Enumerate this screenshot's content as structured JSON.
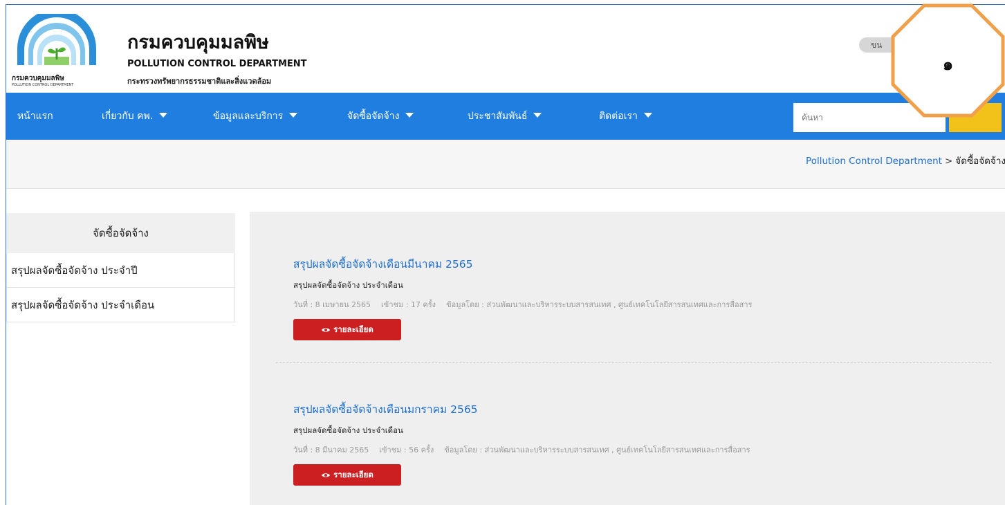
{
  "header": {
    "logo_caption_th": "กรมควบคุมมลพิษ",
    "logo_caption_en": "POLLUTION CONTROL DEPARTMENT",
    "title_th": "กรมควบคุมมลพิษ",
    "title_en": "POLLUTION CONTROL DEPARTMENT",
    "ministry": "กระทรวงทรัพยากรธรรมชาติและสิ่งแวดล้อม",
    "lang_label": "ขน"
  },
  "nav": {
    "items": [
      {
        "label": "หน้าแรก",
        "dropdown": false
      },
      {
        "label": "เกี่ยวกับ คพ.",
        "dropdown": true
      },
      {
        "label": "ข้อมูลและบริการ",
        "dropdown": true
      },
      {
        "label": "จัดซื้อจัดจ้าง",
        "dropdown": true
      },
      {
        "label": "ประชาสัมพันธ์",
        "dropdown": true
      },
      {
        "label": "ติดต่อเรา",
        "dropdown": true
      }
    ],
    "search_placeholder": "ค้นหา"
  },
  "breadcrumb": {
    "home": "Pollution Control Department",
    "separator": ">",
    "current": "จัดซื้อจัดจ้าง"
  },
  "sidebar": {
    "title": "จัดซื้อจัดจ้าง",
    "items": [
      {
        "label": "สรุปผลจัดซื้อจัดจ้าง ประจำปี"
      },
      {
        "label": "สรุปผลจัดซื้อจัดจ้าง ประจำเดือน"
      }
    ]
  },
  "posts": [
    {
      "title": "สรุปผลจัดซื้อจัดจ้างเดือนมีนาคม 2565",
      "category": "สรุปผลจัดซื้อจัดจ้าง ประจำเดือน",
      "date": "วันที่ : 8 เมษายน 2565",
      "views": "เข้าชม : 17 ครั้ง",
      "source": "ข้อมูลโดย : ส่วนพัฒนาและบริหารระบบสารสนเทศ , ศูนย์เทคโนโลยีสารสนเทศและการสื่อสาร",
      "button_label": "รายละเอียด"
    },
    {
      "title": "สรุปผลจัดซื้อจัดจ้างเดือนมกราคม 2565",
      "category": "สรุปผลจัดซื้อจัดจ้าง ประจำเดือน",
      "date": "วันที่ : 8 มีนาคม 2565",
      "views": "เข้าชม : 56 ครั้ง",
      "source": "ข้อมูลโดย : ส่วนพัฒนาและบริหารระบบสารสนเทศ , ศูนย์เทคโนโลยีสารสนเทศและการสื่อสาร",
      "button_label": "รายละเอียด"
    }
  ],
  "annotation": {
    "label": "๑",
    "color": "#f0a04b"
  },
  "colors": {
    "nav_bg": "#1f7ee0",
    "search_button": "#f3c21a",
    "detail_button": "#cc1f22",
    "link": "#1f6fcf"
  }
}
